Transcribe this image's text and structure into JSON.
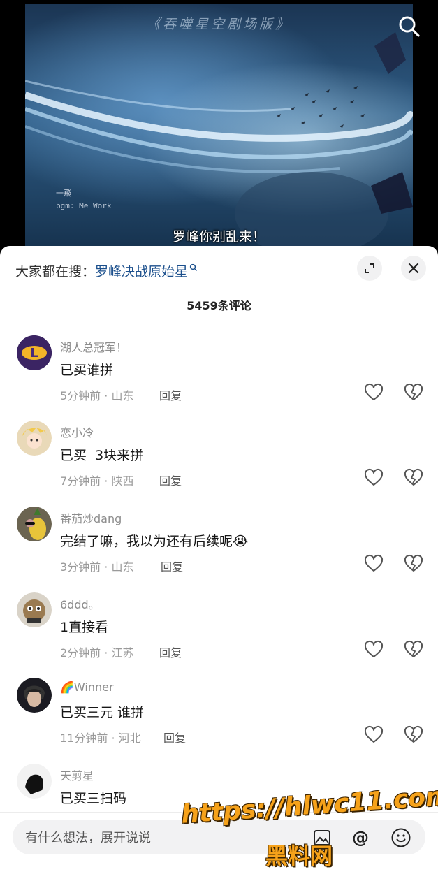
{
  "video": {
    "title": "《吞噬星空剧场版》",
    "credit_name": "一飛",
    "credit_bgm": "bgm: Me Work",
    "subtitle": "罗峰你别乱来！"
  },
  "sheet": {
    "hot_search_prefix": "大家都在搜：",
    "hot_search_keyword": "罗峰决战原始星",
    "comment_count_title": "5459条评论"
  },
  "comments": [
    {
      "user": "湖人总冠军！",
      "text": "已买谁拼",
      "time": "5分钟前",
      "location": "山东",
      "reply": "回复"
    },
    {
      "user": "恋小冷",
      "text": "已买  3块来拼",
      "time": "7分钟前",
      "location": "陕西",
      "reply": "回复"
    },
    {
      "user": "番茄炒dang",
      "text": "完结了嘛，我以为还有后续呢😭",
      "time": "3分钟前",
      "location": "山东",
      "reply": "回复"
    },
    {
      "user": "6ddd。",
      "text": "1直接看",
      "time": "2分钟前",
      "location": "江苏",
      "reply": "回复"
    },
    {
      "user": "🌈Winner",
      "text": "已买三元 谁拼",
      "time": "11分钟前",
      "location": "河北",
      "reply": "回复"
    },
    {
      "user": "天剪星",
      "text": "已买三扫码",
      "time": "",
      "location": "",
      "reply": ""
    }
  ],
  "input": {
    "placeholder": "有什么想法，展开说说"
  },
  "watermark": {
    "url": "https://hlwc11.com",
    "name": "黑料网"
  },
  "icons": {
    "search": "search-icon",
    "expand": "expand-icon",
    "close": "close-icon",
    "like": "heart-icon",
    "dislike": "broken-heart-icon",
    "image": "image-icon",
    "at": "at-icon",
    "emoji": "emoji-icon"
  }
}
